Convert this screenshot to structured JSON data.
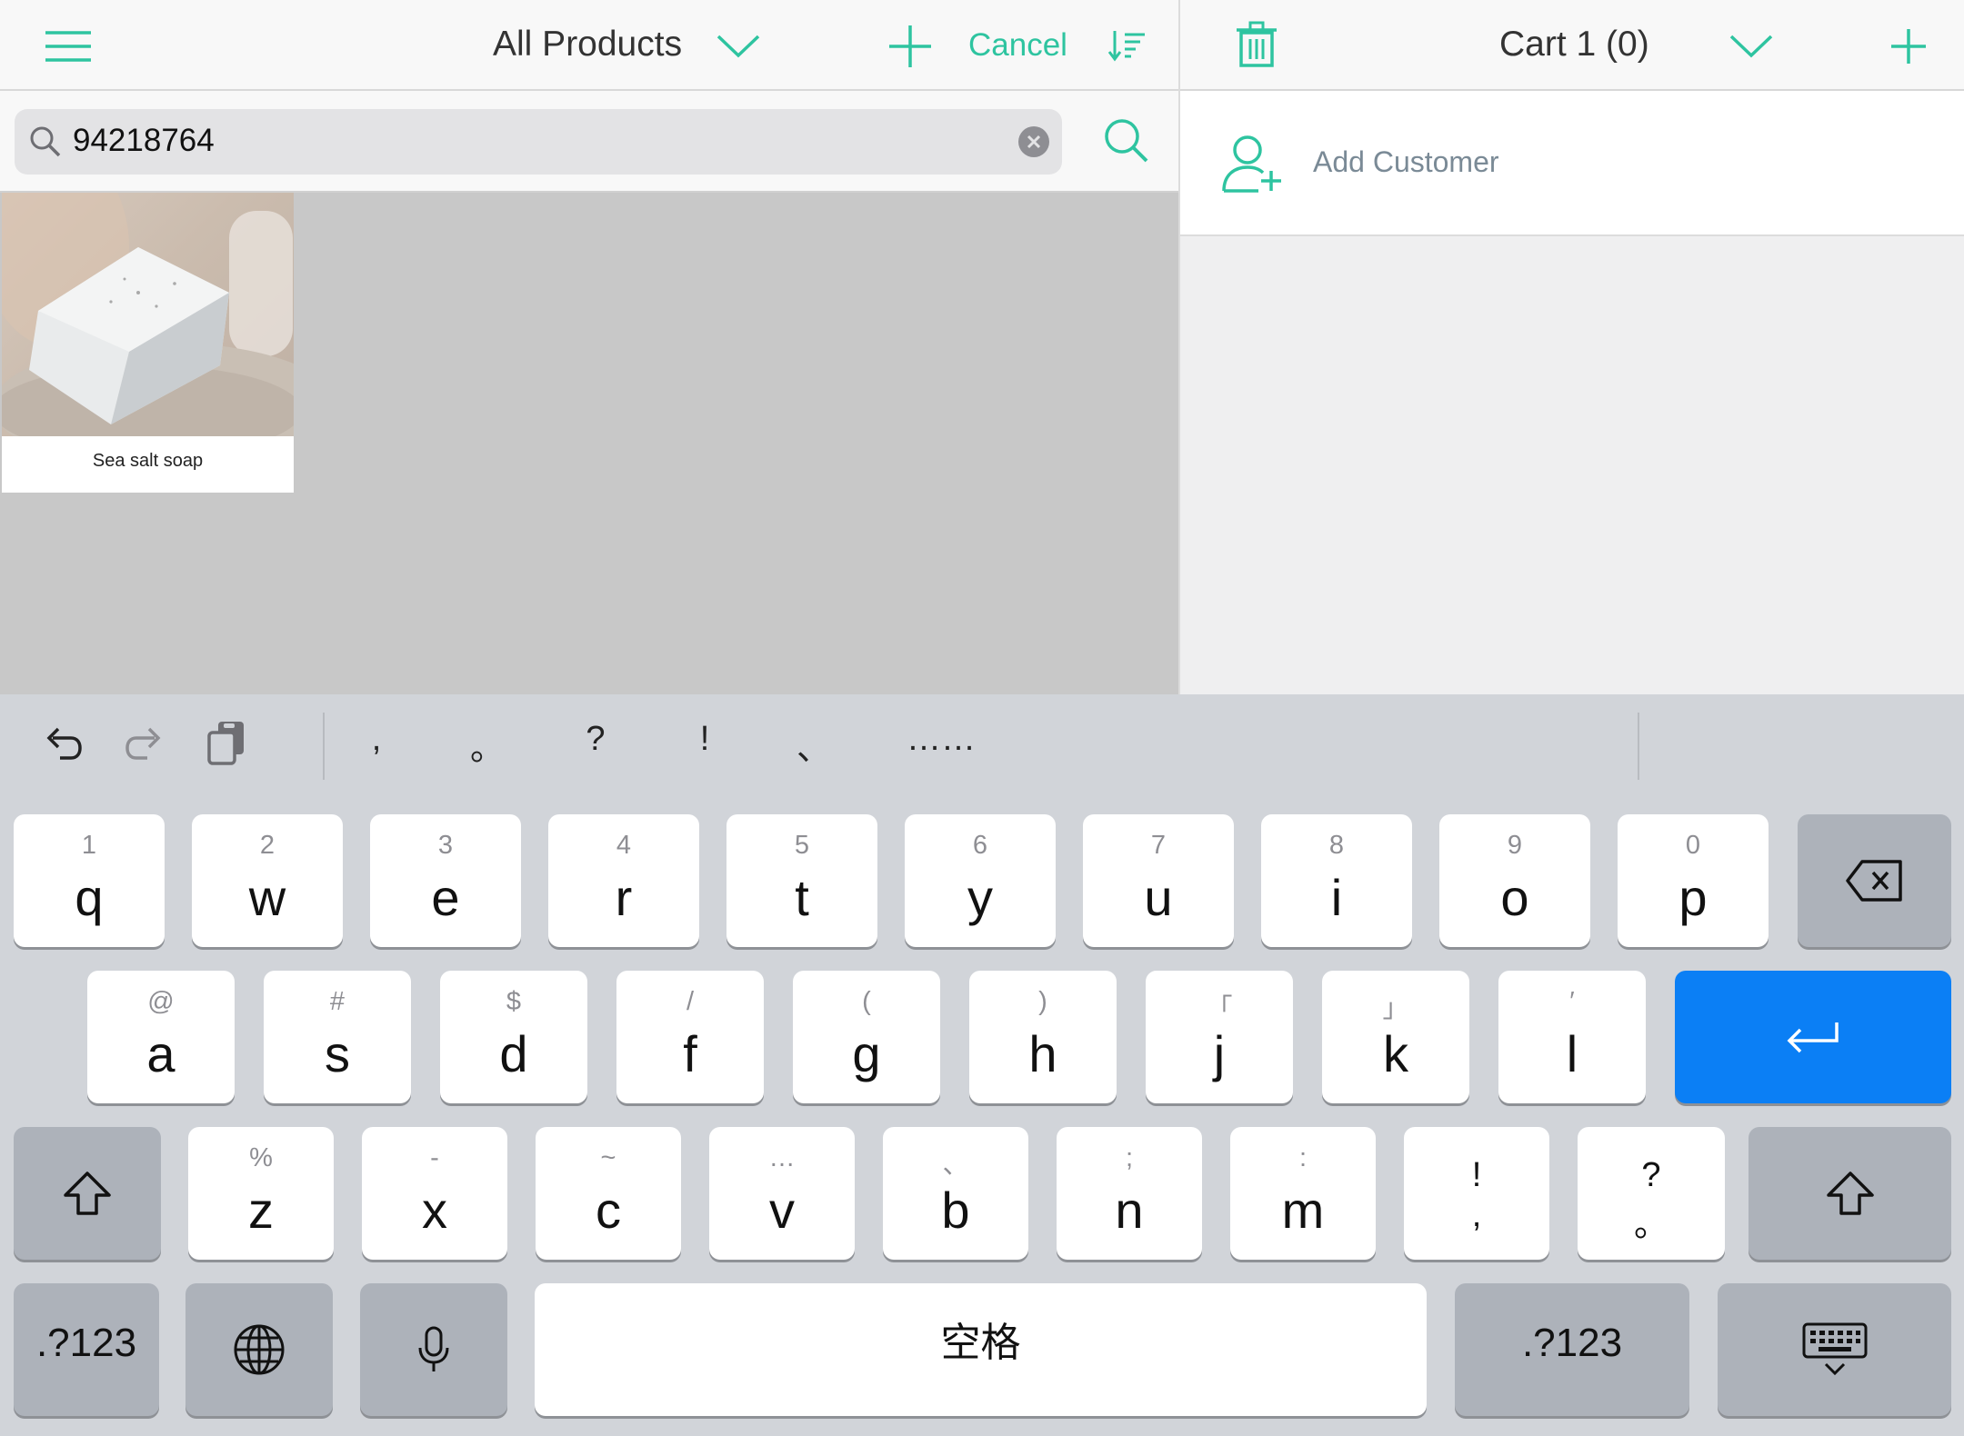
{
  "colors": {
    "accent": "#2ec4a0",
    "return_key": "#0b7ff5"
  },
  "left_header": {
    "menu_icon": "hamburger-icon",
    "title": "All Products",
    "cancel_label": "Cancel"
  },
  "search": {
    "value": "94218764"
  },
  "products": [
    {
      "name": "Sea salt soap"
    }
  ],
  "right_header": {
    "title": "Cart 1 (0)"
  },
  "customer": {
    "label": "Add Customer"
  },
  "keyboard": {
    "toolbar_punct": [
      ",",
      "。",
      "?",
      "!",
      "、",
      "……"
    ],
    "row1": [
      {
        "sub": "1",
        "main": "q"
      },
      {
        "sub": "2",
        "main": "w"
      },
      {
        "sub": "3",
        "main": "e"
      },
      {
        "sub": "4",
        "main": "r"
      },
      {
        "sub": "5",
        "main": "t"
      },
      {
        "sub": "6",
        "main": "y"
      },
      {
        "sub": "7",
        "main": "u"
      },
      {
        "sub": "8",
        "main": "i"
      },
      {
        "sub": "9",
        "main": "o"
      },
      {
        "sub": "0",
        "main": "p"
      }
    ],
    "row2": [
      {
        "sub": "@",
        "main": "a"
      },
      {
        "sub": "#",
        "main": "s"
      },
      {
        "sub": "$",
        "main": "d"
      },
      {
        "sub": "/",
        "main": "f"
      },
      {
        "sub": "(",
        "main": "g"
      },
      {
        "sub": ")",
        "main": "h"
      },
      {
        "sub": "「",
        "main": "j"
      },
      {
        "sub": "」",
        "main": "k"
      },
      {
        "sub": "′",
        "main": "l"
      }
    ],
    "row3": [
      {
        "sub": "%",
        "main": "z"
      },
      {
        "sub": "-",
        "main": "x"
      },
      {
        "sub": "~",
        "main": "c"
      },
      {
        "sub": "…",
        "main": "v"
      },
      {
        "sub": "、",
        "main": "b"
      },
      {
        "sub": ";",
        "main": "n"
      },
      {
        "sub": ":",
        "main": "m"
      }
    ],
    "punct_keys": [
      {
        "top": "!",
        "bottom": ","
      },
      {
        "top": "?",
        "bottom": "。"
      }
    ],
    "numbers_label": ".?123",
    "space_label": "空格"
  }
}
